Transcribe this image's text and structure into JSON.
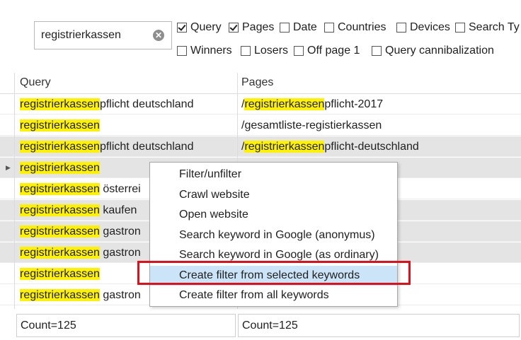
{
  "search": {
    "value": "registrierkassen",
    "clear_glyph": "✕"
  },
  "options_row1": [
    {
      "label": "Query",
      "checked": true
    },
    {
      "label": "Pages",
      "checked": true
    },
    {
      "label": "Date",
      "checked": false
    },
    {
      "label": "Countries",
      "checked": false
    },
    {
      "label": "Devices",
      "checked": false
    },
    {
      "label": "Search Ty",
      "checked": false
    }
  ],
  "options_row2": [
    {
      "label": "Winners",
      "checked": false
    },
    {
      "label": "Losers",
      "checked": false
    },
    {
      "label": "Off page 1",
      "checked": false
    },
    {
      "label": "Query cannibalization",
      "checked": false
    }
  ],
  "table": {
    "headers": {
      "query": "Query",
      "pages": "Pages"
    },
    "rows": [
      {
        "q_hl": "registrierkassen",
        "q_rest": "pflicht deutschland",
        "p_pre": "/",
        "p_hl": "registrierkassen",
        "p_rest": "pflicht-2017",
        "gray": false
      },
      {
        "q_hl": "registrierkassen",
        "q_rest": "",
        "p_pre": "/gesamtliste-registierkassen",
        "p_hl": "",
        "p_rest": "",
        "gray": false
      },
      {
        "q_hl": "registrierkassen",
        "q_rest": "pflicht deutschland",
        "p_pre": "/",
        "p_hl": "registrierkassen",
        "p_rest": "pflicht-deutschland",
        "gray": true
      },
      {
        "q_hl": "registrierkassen",
        "q_rest": "",
        "p_pre": "",
        "p_hl": "",
        "p_rest": "",
        "gray": true,
        "current": true
      },
      {
        "q_hl": "registrierkassen",
        "q_rest": " österrei",
        "p_pre": "",
        "p_hl": "",
        "p_rest": "",
        "gray": false
      },
      {
        "q_hl": "registrierkassen",
        "q_rest": " kaufen",
        "p_pre": "",
        "p_hl": "",
        "p_rest": "",
        "gray": true
      },
      {
        "q_hl": "registrierkassen",
        "q_rest": " gastron",
        "p_pre": "",
        "p_hl": "n",
        "p_rest": "-und-kassensysteme",
        "gray": true
      },
      {
        "q_hl": "registrierkassen",
        "q_rest": " gastron",
        "p_pre": "",
        "p_hl": "",
        "p_rest": "",
        "gray": true
      },
      {
        "q_hl": "registrierkassen",
        "q_rest": "",
        "p_pre": "",
        "p_hl": "",
        "p_rest": "",
        "gray": false
      },
      {
        "q_hl": "registrierkassen",
        "q_rest": " gastron",
        "p_pre": "",
        "p_hl": "",
        "p_rest": "",
        "gray": false
      },
      {
        "q_hl": "registrierkassen",
        "q_rest": "",
        "p_pre": "",
        "p_hl": "",
        "p_rest": "",
        "gray": false
      }
    ],
    "current_row_marker": "▶"
  },
  "context_menu": {
    "items": [
      {
        "label": "Filter/unfilter"
      },
      {
        "label": "Crawl website"
      },
      {
        "label": "Open website"
      },
      {
        "label": "Search keyword in Google (anonymus)"
      },
      {
        "label": "Search keyword in Google (as ordinary)"
      },
      {
        "label": "Create filter from selected keywords",
        "selected": true
      },
      {
        "label": "Create filter from all keywords"
      }
    ]
  },
  "footer": {
    "query_count": "Count=125",
    "pages_count": "Count=125"
  },
  "colors": {
    "highlight": "#fff200",
    "selection": "#cce4f7",
    "annotation_box": "#e0101a"
  }
}
